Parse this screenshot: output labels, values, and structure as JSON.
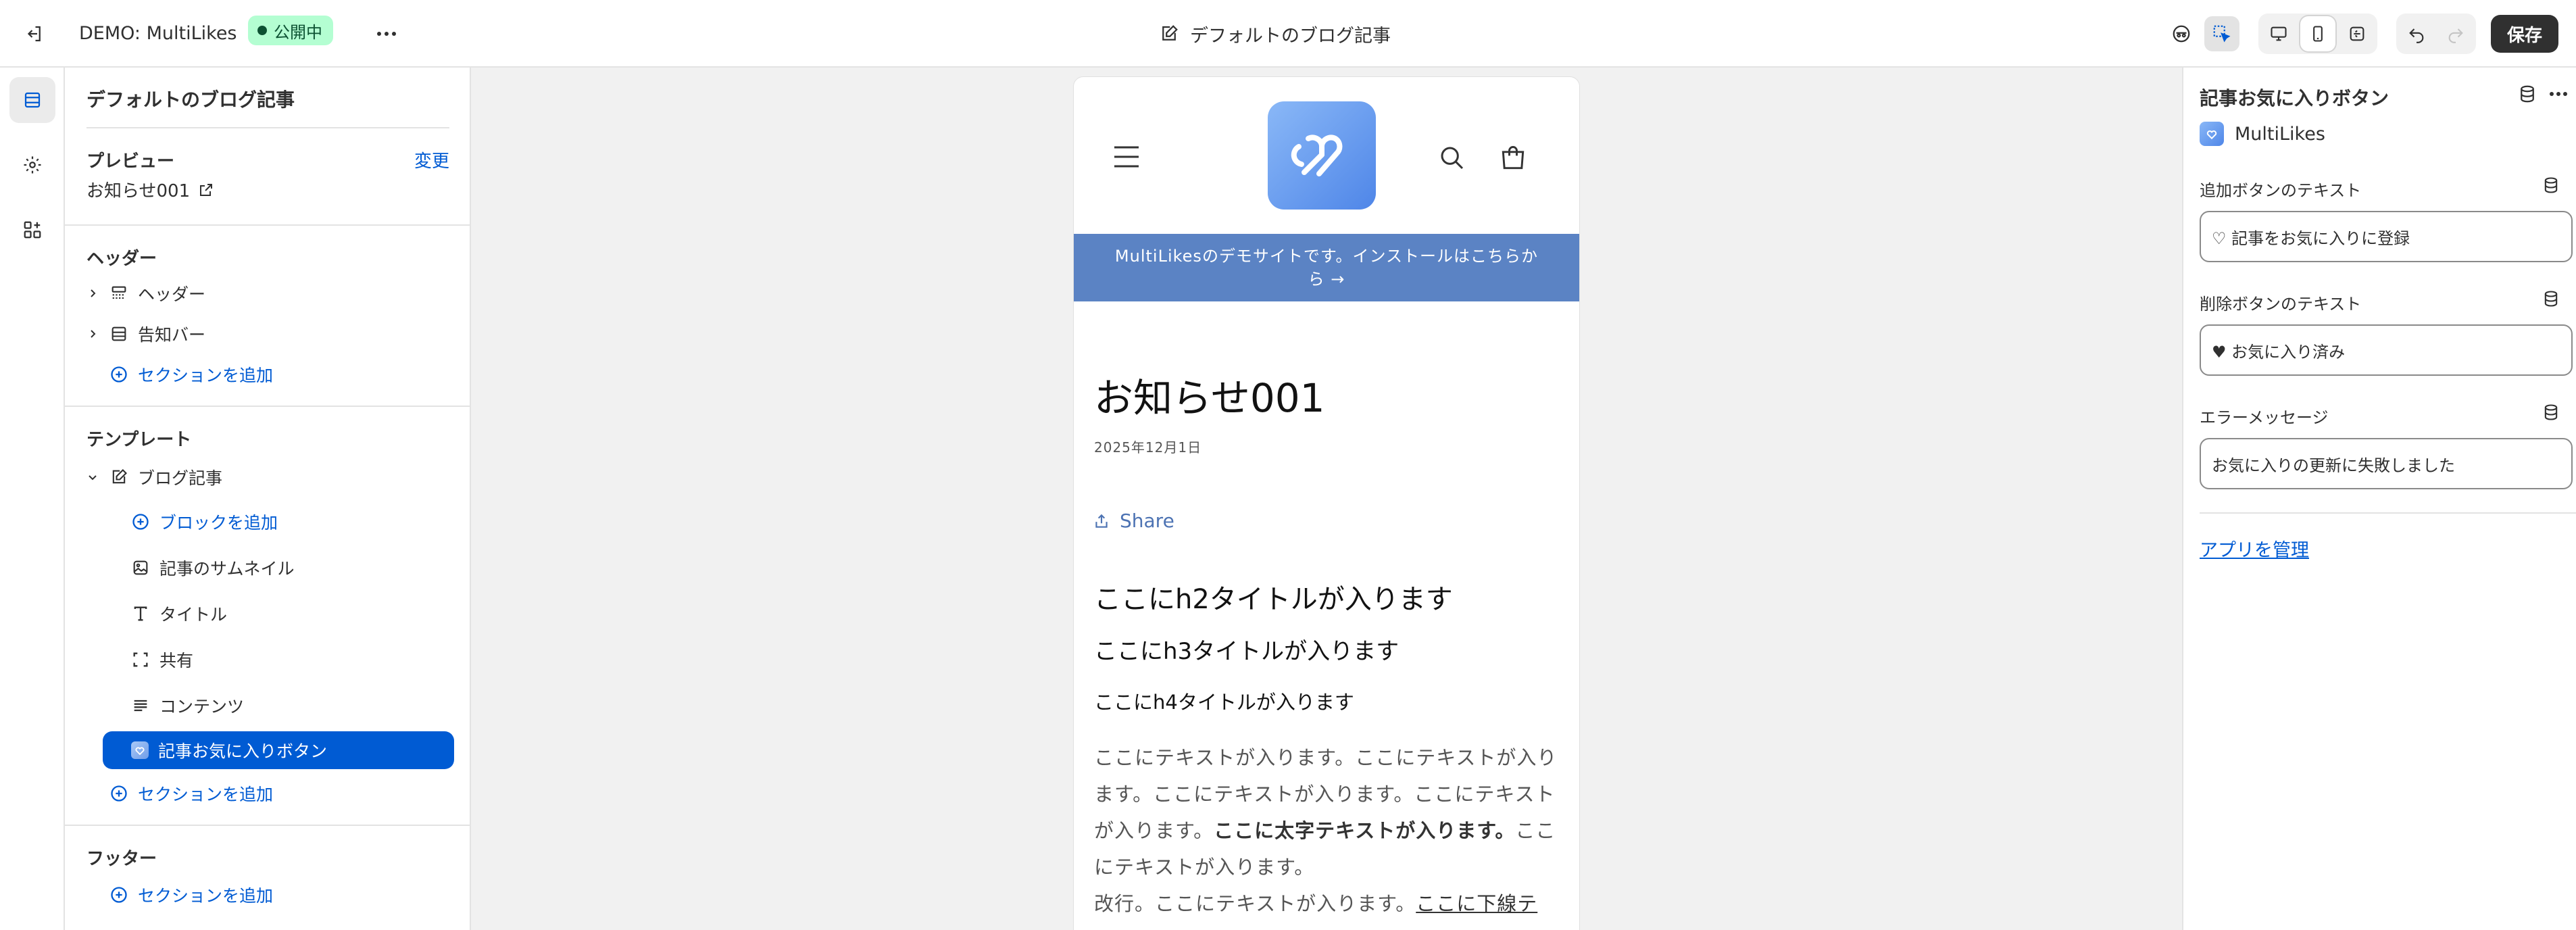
{
  "topbar": {
    "store_name": "DEMO: MultiLikes",
    "status_badge": "公開中",
    "page_title": "デフォルトのブログ記事",
    "save_label": "保存"
  },
  "left_panel": {
    "title": "デフォルトのブログ記事",
    "preview": {
      "heading": "プレビュー",
      "change_link": "変更",
      "value": "お知らせ001"
    },
    "header_group": {
      "heading": "ヘッダー",
      "items": [
        {
          "label": "ヘッダー",
          "icon": "layout-header-icon"
        },
        {
          "label": "告知バー",
          "icon": "layout-section-icon"
        }
      ],
      "add_section": "セクションを追加"
    },
    "template_group": {
      "heading": "テンプレート",
      "section": "ブログ記事",
      "add_block": "ブロックを追加",
      "blocks": [
        {
          "label": "記事のサムネイル",
          "icon": "image-icon"
        },
        {
          "label": "タイトル",
          "icon": "text-title-icon"
        },
        {
          "label": "共有",
          "icon": "share-frame-icon"
        },
        {
          "label": "コンテンツ",
          "icon": "text-align-icon"
        },
        {
          "label": "記事お気に入りボタン",
          "icon": "app-block-icon",
          "selected": true
        }
      ],
      "add_section": "セクションを追加"
    },
    "footer_group": {
      "heading": "フッター",
      "add_section": "セクションを追加"
    }
  },
  "preview": {
    "announcement": "MultiLikesのデモサイトです。インストールはこちらから",
    "article_title": "お知らせ001",
    "date": "2025年12月1日",
    "share_label": "Share",
    "h2": "ここにh2タイトルが入ります",
    "h3": "ここにh3タイトルが入ります",
    "h4": "ここにh4タイトルが入ります",
    "body_1": "ここにテキストが入ります。ここにテキストが入ります。ここにテキストが入ります。ここにテキストが入ります。",
    "body_bold": "ここに太字テキストが入ります。",
    "body_2": "ここにテキストが入ります。",
    "body_3": "改行。ここにテキストが入ります。",
    "body_underline": "ここに下線テ"
  },
  "right_panel": {
    "title": "記事お気に入りボタン",
    "app_name": "MultiLikes",
    "fields": [
      {
        "label": "追加ボタンのテキスト",
        "value": "♡ 記事をお気に入りに登録"
      },
      {
        "label": "削除ボタンのテキスト",
        "value": "♥ お気に入り済み"
      },
      {
        "label": "エラーメッセージ",
        "value": "お気に入りの更新に失敗しました"
      }
    ],
    "manage_link": "アプリを管理"
  },
  "colors": {
    "accent": "#005bd3",
    "badge_bg": "#b4fed2",
    "announcement_bg": "#5b83c4",
    "save_bg": "#303030"
  }
}
